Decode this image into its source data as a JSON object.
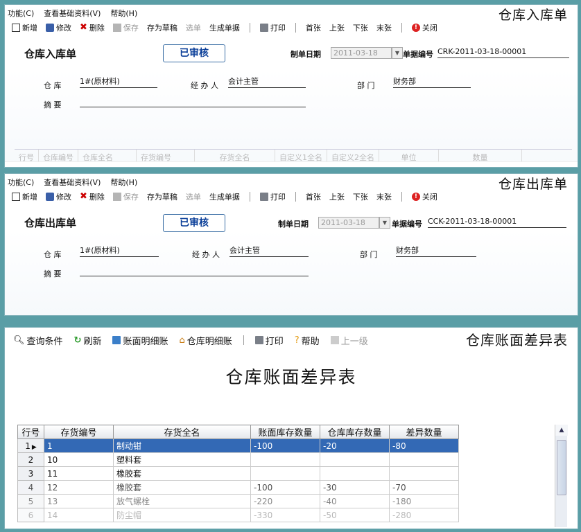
{
  "inbound": {
    "menu": [
      "功能(C)",
      "查看基础资料(V)",
      "帮助(H)"
    ],
    "corner_title": "仓库入库单",
    "toolbar": {
      "new": "新增",
      "edit": "修改",
      "delete": "删除",
      "save": "保存",
      "draft": "存为草稿",
      "pick": "选单",
      "gen": "生成单据",
      "print": "打印",
      "first": "首张",
      "prev": "上张",
      "next": "下张",
      "last": "末张",
      "close": "关闭"
    },
    "form_title": "仓库入库单",
    "status": "已审核",
    "date_label": "制单日期",
    "date_value": "2011-03-18",
    "docno_label": "单据编号",
    "docno_value": "CRK-2011-03-18-00001",
    "warehouse_label": "仓 库",
    "warehouse_value": "1#(原材料)",
    "handler_label": "经 办 人",
    "handler_value": "会计主管",
    "dept_label": "部 门",
    "dept_value": "财务部",
    "summary_label": "摘 要",
    "summary_value": "",
    "grid_columns": [
      "行号",
      "仓库编号",
      "仓库全名",
      "存货编号",
      "存货全名",
      "自定义1全名",
      "自定义2全名",
      "单位",
      "数量"
    ]
  },
  "outbound": {
    "menu": [
      "功能(C)",
      "查看基础资料(V)",
      "帮助(H)"
    ],
    "corner_title": "仓库出库单",
    "toolbar": {
      "new": "新增",
      "edit": "修改",
      "delete": "删除",
      "save": "保存",
      "draft": "存为草稿",
      "pick": "选单",
      "gen": "生成单据",
      "print": "打印",
      "first": "首张",
      "prev": "上张",
      "next": "下张",
      "last": "末张",
      "close": "关闭"
    },
    "form_title": "仓库出库单",
    "status": "已审核",
    "date_label": "制单日期",
    "date_value": "2011-03-18",
    "docno_label": "单据编号",
    "docno_value": "CCK-2011-03-18-00001",
    "warehouse_label": "仓 库",
    "warehouse_value": "1#(原材料)",
    "handler_label": "经 办 人",
    "handler_value": "会计主管",
    "dept_label": "部 门",
    "dept_value": "财务部",
    "summary_label": "摘 要",
    "summary_value": ""
  },
  "diff": {
    "corner_title": "仓库账面差异表",
    "toolbar": {
      "query": "查询条件",
      "refresh": "刷新",
      "ledger": "账面明细账",
      "wh_ledger": "仓库明细账",
      "print": "打印",
      "help": "帮助",
      "up": "上一级"
    },
    "report_title": "仓库账面差异表",
    "columns": [
      "行号",
      "存货编号",
      "存货全名",
      "账面库存数量",
      "仓库库存数量",
      "差异数量"
    ],
    "rows": [
      {
        "no": "1",
        "code": "1",
        "name": "制动钳",
        "book": "-100",
        "wh": "-20",
        "diff": "-80"
      },
      {
        "no": "2",
        "code": "10",
        "name": "塑料套",
        "book": "",
        "wh": "",
        "diff": ""
      },
      {
        "no": "3",
        "code": "11",
        "name": "橡胶套",
        "book": "",
        "wh": "",
        "diff": ""
      },
      {
        "no": "4",
        "code": "12",
        "name": "橡胶套",
        "book": "-100",
        "wh": "-30",
        "diff": "-70"
      },
      {
        "no": "5",
        "code": "13",
        "name": "放气螺栓",
        "book": "-220",
        "wh": "-40",
        "diff": "-180"
      },
      {
        "no": "6",
        "code": "14",
        "name": "防尘帽",
        "book": "-330",
        "wh": "-50",
        "diff": "-280"
      }
    ]
  }
}
